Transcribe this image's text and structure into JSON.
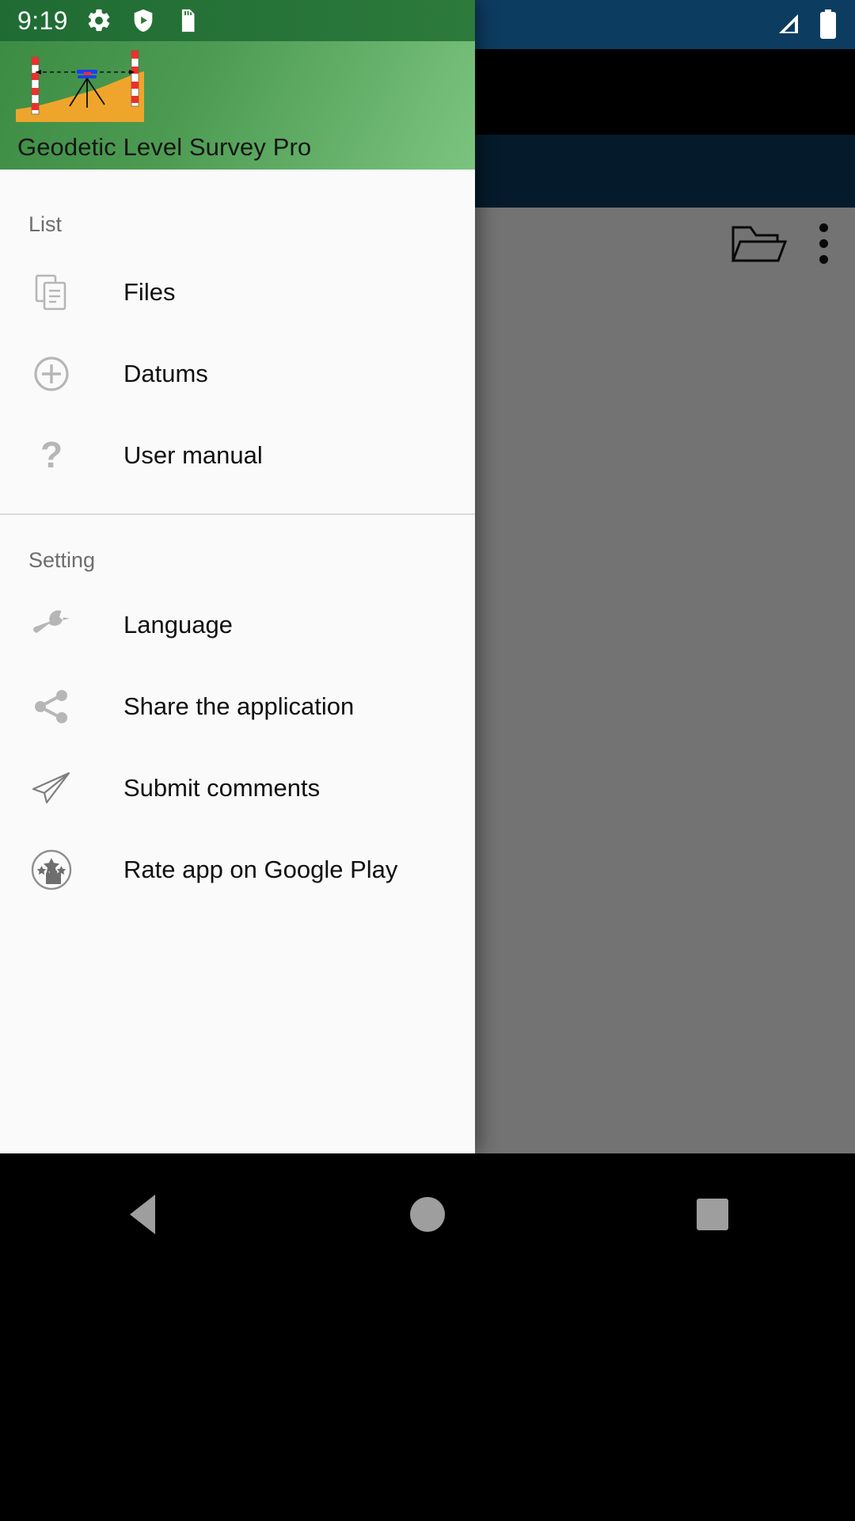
{
  "status_bar": {
    "time": "9:19",
    "left_icons": [
      "gear-icon",
      "play-protect-shield-icon",
      "sd-card-icon"
    ],
    "right_icons": [
      "signal-strength-icon",
      "battery-icon"
    ]
  },
  "drawer": {
    "header": {
      "app_title": "Geodetic Level Survey Pro",
      "illustration": "surveying-level-tripod-staff-illustration",
      "gradient_from": "#3d8c44",
      "gradient_to": "#7bc47f"
    },
    "sections": [
      {
        "label": "List",
        "items": [
          {
            "label": "Files",
            "icon": "documents-copy-icon"
          },
          {
            "label": "Datums",
            "icon": "plus-circle-icon"
          },
          {
            "label": "User manual",
            "icon": "question-mark-icon"
          }
        ]
      },
      {
        "label": "Setting",
        "items": [
          {
            "label": "Language",
            "icon": "wrench-icon"
          },
          {
            "label": "Share the application",
            "icon": "share-nodes-icon"
          },
          {
            "label": "Submit comments",
            "icon": "paper-plane-send-icon"
          },
          {
            "label": "Rate app on Google Play",
            "icon": "rate-hand-stars-icon"
          }
        ]
      }
    ]
  },
  "background_app": {
    "toolbar": {
      "icons": [
        "folder-open-icon",
        "overflow-menu-icon"
      ]
    },
    "bottom_button": {
      "label": ""
    },
    "accent_color": "#0d3c61"
  },
  "navigation_bar": {
    "buttons": [
      {
        "name": "back",
        "icon": "triangle-back-icon"
      },
      {
        "name": "home",
        "icon": "circle-home-icon"
      },
      {
        "name": "recents",
        "icon": "square-recents-icon"
      }
    ]
  }
}
